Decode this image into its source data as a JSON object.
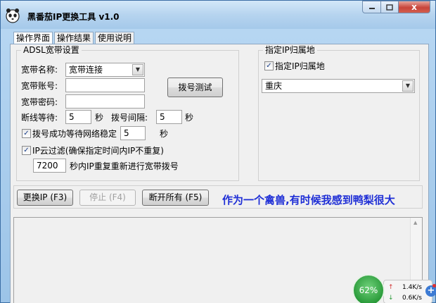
{
  "window": {
    "title": "黑番茄IP更换工具 v1.0",
    "min_icon": "minimize-icon",
    "max_icon": "maximize-icon",
    "close_icon": "close-icon",
    "close_glyph": "x"
  },
  "tabs": [
    {
      "label": "操作界面",
      "active": true
    },
    {
      "label": "操作结果",
      "active": false
    },
    {
      "label": "使用说明",
      "active": false
    }
  ],
  "adsl": {
    "group_title": "ADSL宽带设置",
    "name_label": "宽带名称:",
    "name_value": "宽带连接",
    "account_label": "宽带账号:",
    "account_value": "",
    "password_label": "宽带密码:",
    "password_value": "",
    "disconnect_wait_label": "断线等待:",
    "disconnect_wait_value": "5",
    "disconnect_wait_unit": "秒",
    "dial_interval_label": "拨号间隔:",
    "dial_interval_value": "5",
    "dial_interval_unit": "秒",
    "wait_network_label": "拨号成功等待网络稳定",
    "wait_network_checked": true,
    "wait_network_value": "5",
    "wait_network_unit": "秒",
    "ip_filter_label": "IP云过滤(确保指定时间内IP不重复)",
    "ip_filter_checked": true,
    "ip_filter_value": "7200",
    "ip_filter_suffix": "秒内IP重复重新进行宽带拨号",
    "test_dial_label": "拨号测试"
  },
  "location": {
    "group_title": "指定IP归属地",
    "checkbox_label": "指定IP归属地",
    "checked": true,
    "selected": "重庆"
  },
  "actions": {
    "change_ip_label": "更换IP (F3)",
    "stop_label": "停止 (F4)",
    "disconnect_all_label": "断开所有 (F5)",
    "slogan": "作为一个禽兽,有时候我感到鸭梨很大"
  },
  "net_monitor": {
    "percent": "62%",
    "upload": "1.4K/s",
    "download": "0.6K/s",
    "up_arrow": "↑",
    "down_arrow": "↓",
    "plus": "+"
  },
  "colors": {
    "slogan": "#1f2fd6",
    "net_circle": "#2a9b3a",
    "close_button": "#c8443a"
  }
}
